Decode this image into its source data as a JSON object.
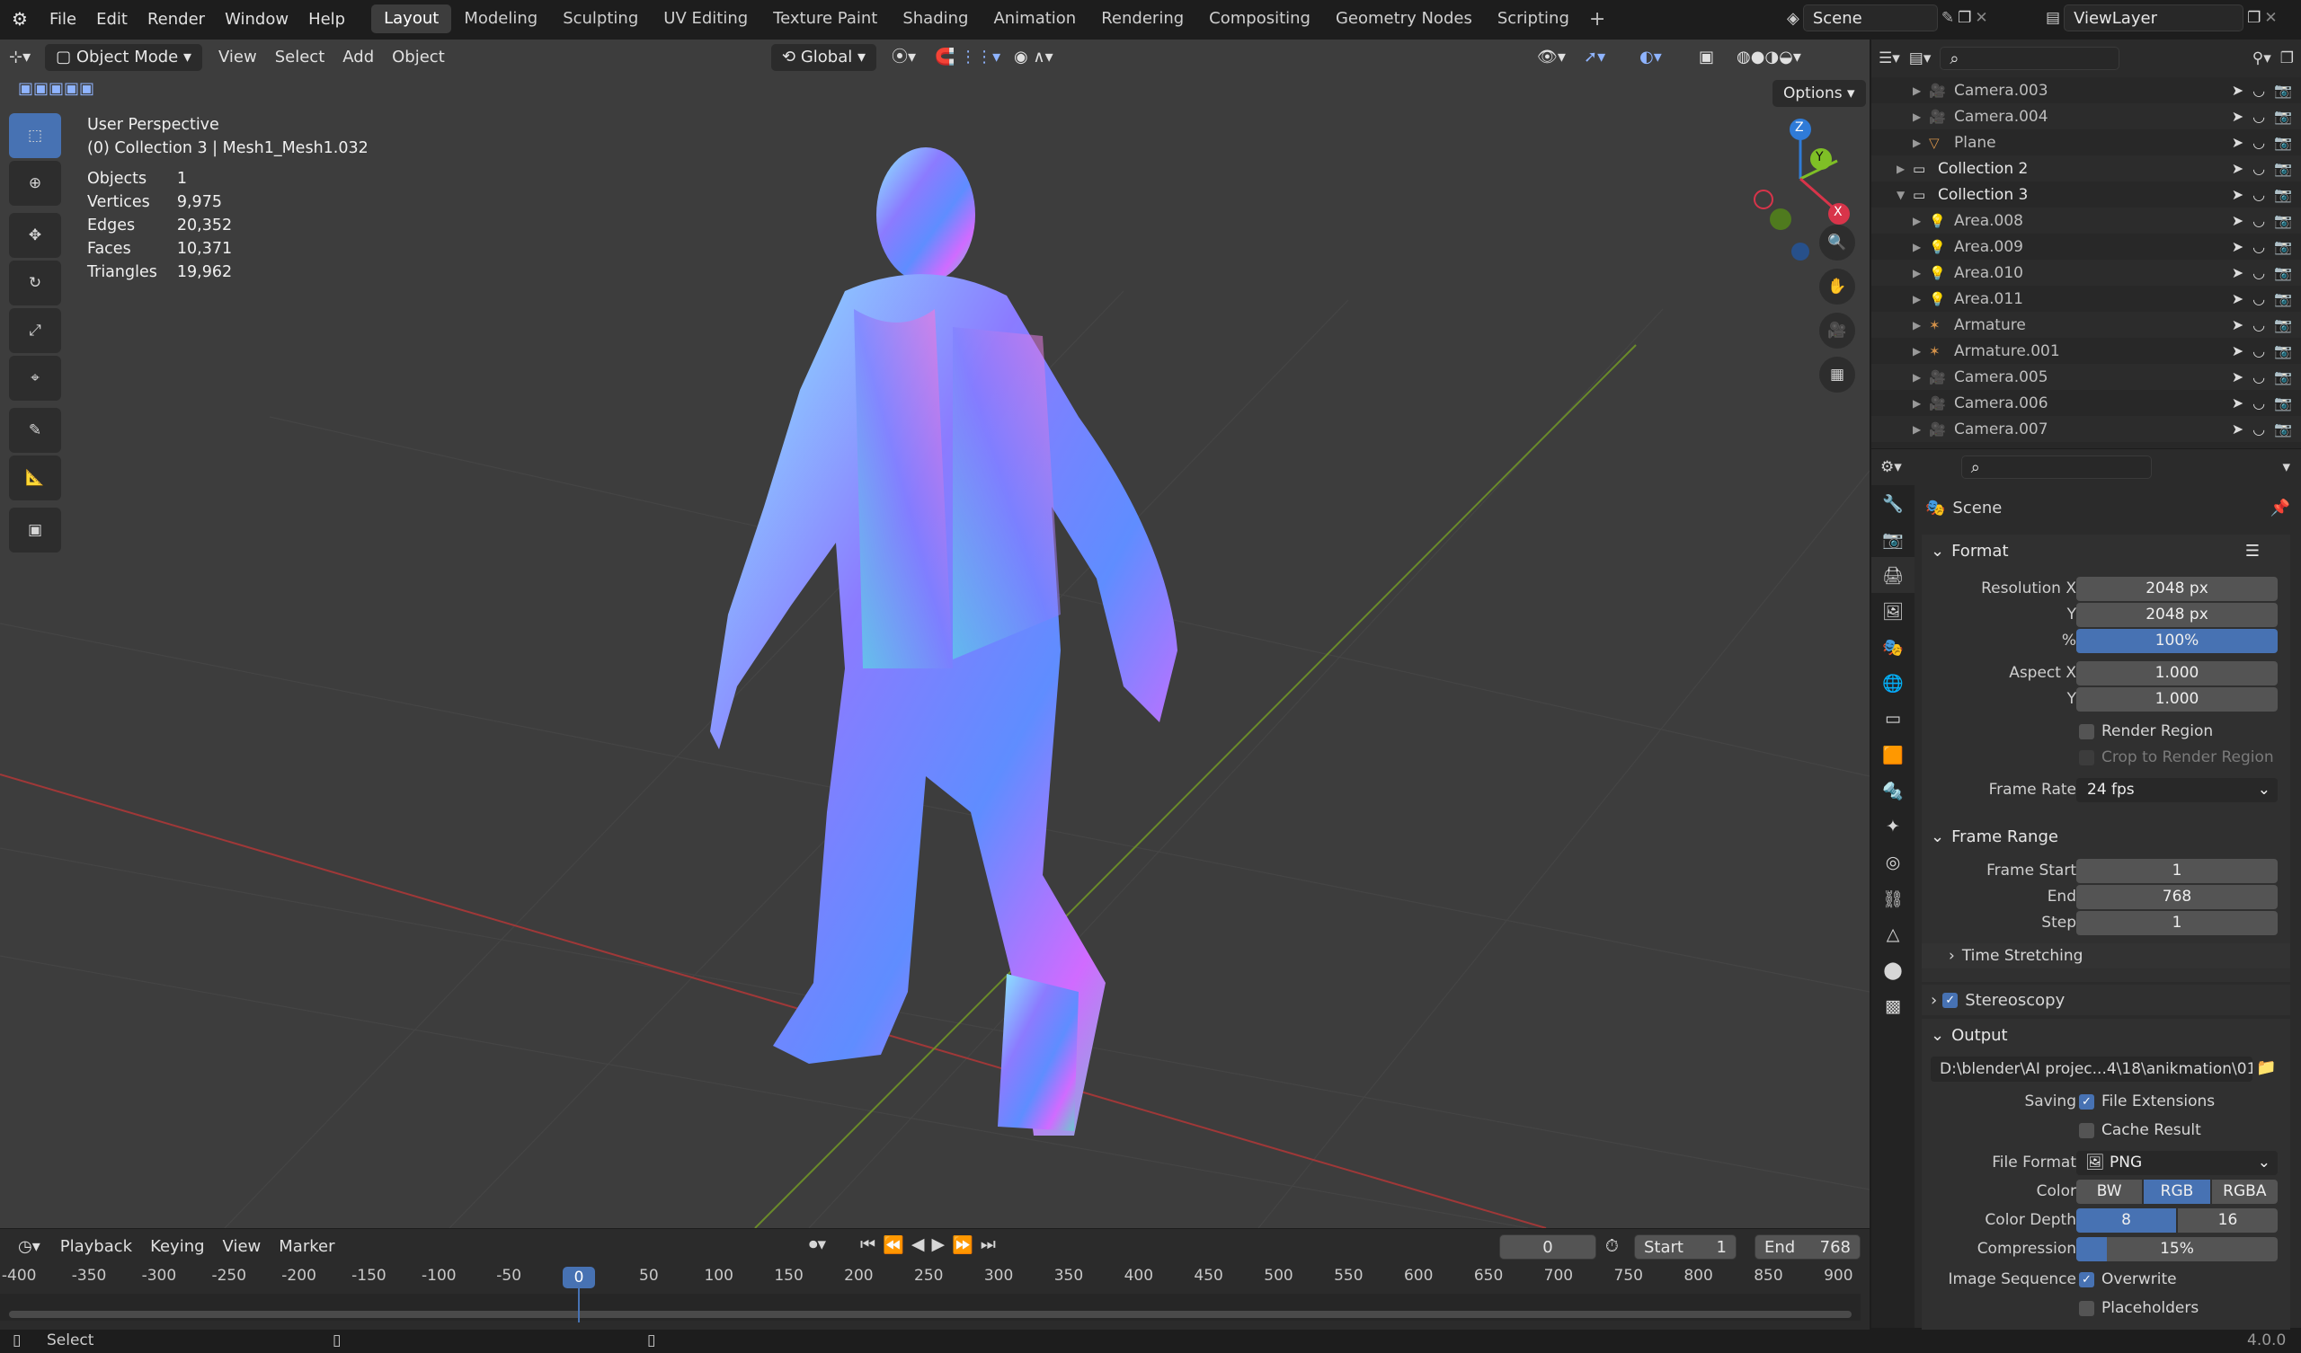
{
  "menu": {
    "items": [
      "File",
      "Edit",
      "Render",
      "Window",
      "Help"
    ]
  },
  "workspaces": [
    "Layout",
    "Modeling",
    "Sculpting",
    "UV Editing",
    "Texture Paint",
    "Shading",
    "Animation",
    "Rendering",
    "Compositing",
    "Geometry Nodes",
    "Scripting"
  ],
  "scene": "Scene",
  "view_layer": "ViewLayer",
  "viewport_header": {
    "mode": "Object Mode",
    "menus": [
      "View",
      "Select",
      "Add",
      "Object"
    ],
    "orientation": "Global",
    "options": "Options"
  },
  "overlay_text": {
    "perspective": "User Perspective",
    "context": "(0) Collection 3 | Mesh1_Mesh1.032"
  },
  "stats": [
    [
      "Objects",
      "1"
    ],
    [
      "Vertices",
      "9,975"
    ],
    [
      "Edges",
      "20,352"
    ],
    [
      "Faces",
      "10,371"
    ],
    [
      "Triangles",
      "19,962"
    ]
  ],
  "gizmo": {
    "z": "Z",
    "y": "Y",
    "x": "X"
  },
  "outliner": {
    "rows": [
      {
        "name": "Camera.003",
        "indent": 2,
        "icon": "camera-icon"
      },
      {
        "name": "Camera.004",
        "indent": 2,
        "icon": "camera-icon"
      },
      {
        "name": "Plane",
        "indent": 2,
        "icon": "mesh-icon"
      },
      {
        "name": "Collection 2",
        "indent": 1,
        "icon": "collection-icon"
      },
      {
        "name": "Collection 3",
        "indent": 1,
        "icon": "collection-icon"
      },
      {
        "name": "Area.008",
        "indent": 2,
        "icon": "light-icon"
      },
      {
        "name": "Area.009",
        "indent": 2,
        "icon": "light-icon"
      },
      {
        "name": "Area.010",
        "indent": 2,
        "icon": "light-icon"
      },
      {
        "name": "Area.011",
        "indent": 2,
        "icon": "light-icon"
      },
      {
        "name": "Armature",
        "indent": 2,
        "icon": "armature-icon"
      },
      {
        "name": "Armature.001",
        "indent": 2,
        "icon": "armature-icon"
      },
      {
        "name": "Camera.005",
        "indent": 2,
        "icon": "camera-icon"
      },
      {
        "name": "Camera.006",
        "indent": 2,
        "icon": "camera-icon"
      },
      {
        "name": "Camera.007",
        "indent": 2,
        "icon": "camera-icon"
      }
    ]
  },
  "properties": {
    "context": "Scene",
    "format": {
      "title": "Format",
      "res_x_label": "Resolution X",
      "res_x": "2048 px",
      "res_y_label": "Y",
      "res_y": "2048 px",
      "pct_label": "%",
      "pct": "100%",
      "aspect_x_label": "Aspect X",
      "aspect_x": "1.000",
      "aspect_y_label": "Y",
      "aspect_y": "1.000",
      "render_region": "Render Region",
      "crop": "Crop to Render Region",
      "frame_rate_label": "Frame Rate",
      "frame_rate": "24 fps"
    },
    "frame_range": {
      "title": "Frame Range",
      "start_label": "Frame Start",
      "start": "1",
      "end_label": "End",
      "end": "768",
      "step_label": "Step",
      "step": "1",
      "time_stretching": "Time Stretching"
    },
    "stereoscopy": "Stereoscopy",
    "output": {
      "title": "Output",
      "path": "D:\\blender\\AI projec...4\\18\\anikmation\\01",
      "saving_label": "Saving",
      "file_ext": "File Extensions",
      "cache": "Cache Result",
      "file_format_label": "File Format",
      "file_format": "PNG",
      "color_label": "Color",
      "color_opts": [
        "BW",
        "RGB",
        "RGBA"
      ],
      "depth_label": "Color Depth",
      "depth_opts": [
        "8",
        "16"
      ],
      "compression_label": "Compression",
      "compression": "15%",
      "compression_value": 0.15,
      "imgseq_label": "Image Sequence",
      "overwrite": "Overwrite",
      "placeholders": "Placeholders"
    }
  },
  "timeline": {
    "menus": [
      "Playback",
      "Keying",
      "View",
      "Marker"
    ],
    "current": "0",
    "start_label": "Start",
    "start": "1",
    "end_label": "End",
    "end": "768",
    "ticks": [
      "-400",
      "-350",
      "-300",
      "-250",
      "-200",
      "-150",
      "-100",
      "-50",
      "0",
      "50",
      "100",
      "150",
      "200",
      "250",
      "300",
      "350",
      "400",
      "450",
      "500",
      "550",
      "600",
      "650",
      "700",
      "750",
      "800",
      "850",
      "900"
    ]
  },
  "status": {
    "select": "Select",
    "version": "4.0.0"
  }
}
